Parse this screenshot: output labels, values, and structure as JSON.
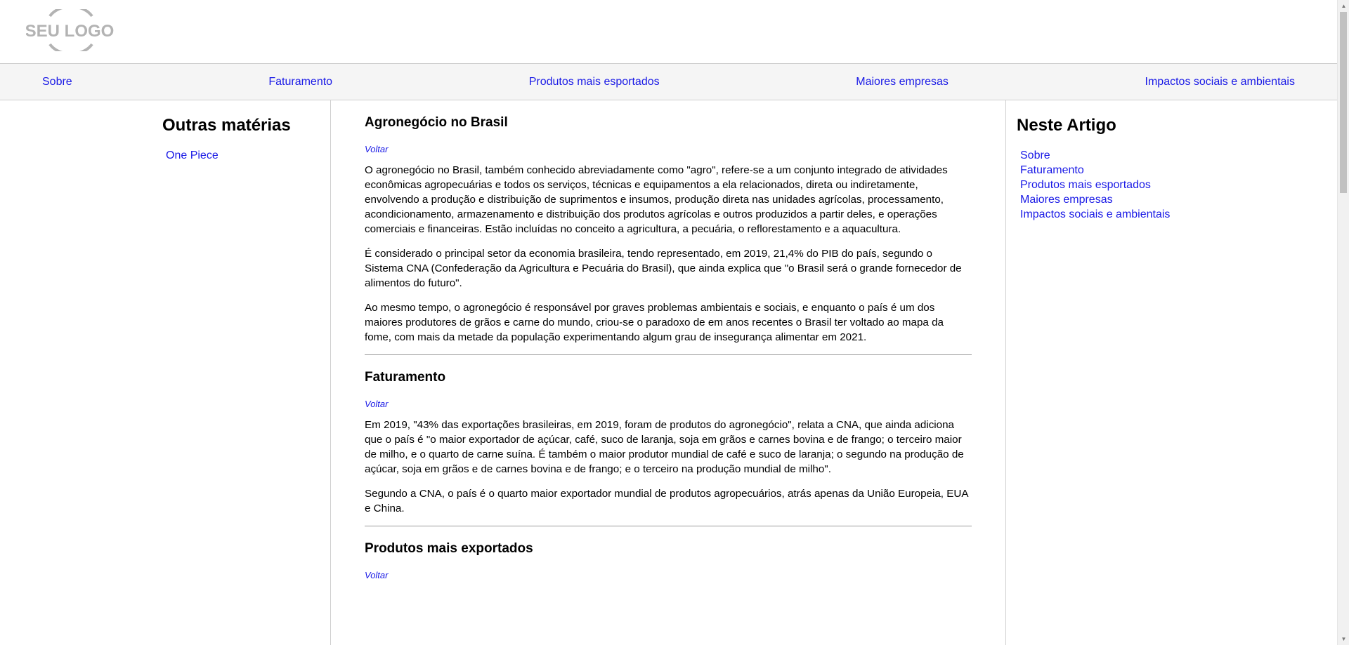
{
  "logo": {
    "text": "SEU LOGO",
    "color": "#b3b3b3"
  },
  "nav": {
    "items": [
      "Sobre",
      "Faturamento",
      "Produtos mais esportados",
      "Maiores empresas",
      "Impactos sociais e ambientais"
    ]
  },
  "left_sidebar": {
    "title": "Outras matérias",
    "items": [
      "One Piece"
    ]
  },
  "right_sidebar": {
    "title": "Neste Artigo",
    "items": [
      "Sobre",
      "Faturamento",
      "Produtos mais esportados",
      "Maiores empresas",
      "Impactos sociais e ambientais"
    ]
  },
  "main": {
    "sections": [
      {
        "title": "Agronegócio no Brasil",
        "back_label": "Voltar",
        "paragraphs": [
          "O agronegócio no Brasil, também conhecido abreviadamente como \"agro\", refere-se a um conjunto integrado de atividades econômicas agropecuárias e todos os serviços, técnicas e equipamentos a ela relacionados, direta ou indiretamente, envolvendo a produção e distribuição de suprimentos e insumos, produção direta nas unidades agrícolas, processamento, acondicionamento, armazenamento e distribuição dos produtos agrícolas e outros produzidos a partir deles, e operações comerciais e financeiras. Estão incluídas no conceito a agricultura, a pecuária, o reflorestamento e a aquacultura.",
          "É considerado o principal setor da economia brasileira, tendo representado, em 2019, 21,4% do PIB do país, segundo o Sistema CNA (Confederação da Agricultura e Pecuária do Brasil), que ainda explica que \"o Brasil será o grande fornecedor de alimentos do futuro\".",
          "Ao mesmo tempo, o agronegócio é responsável por graves problemas ambientais e sociais, e enquanto o país é um dos maiores produtores de grãos e carne do mundo, criou-se o paradoxo de em anos recentes o Brasil ter voltado ao mapa da fome, com mais da metade da população experimentando algum grau de insegurança alimentar em 2021."
        ]
      },
      {
        "title": "Faturamento",
        "back_label": "Voltar",
        "paragraphs": [
          "Em 2019, \"43% das exportações brasileiras, em 2019, foram de produtos do agronegócio\", relata a CNA, que ainda adiciona que o país é \"o maior exportador de açúcar, café, suco de laranja, soja em grãos e carnes bovina e de frango; o terceiro maior de milho, e o quarto de carne suína. É também o maior produtor mundial de café e suco de laranja; o segundo na produção de açúcar, soja em grãos e de carnes bovina e de frango; e o terceiro na produção mundial de milho\".",
          "Segundo a CNA, o país é o quarto maior exportador mundial de produtos agropecuários, atrás apenas da União Europeia, EUA e China."
        ]
      },
      {
        "title": "Produtos mais exportados",
        "back_label": "Voltar",
        "paragraphs": []
      }
    ]
  },
  "colors": {
    "link": "#1a1ae6",
    "nav_background": "#f5f5f5",
    "divider": "#cfcfcf"
  }
}
